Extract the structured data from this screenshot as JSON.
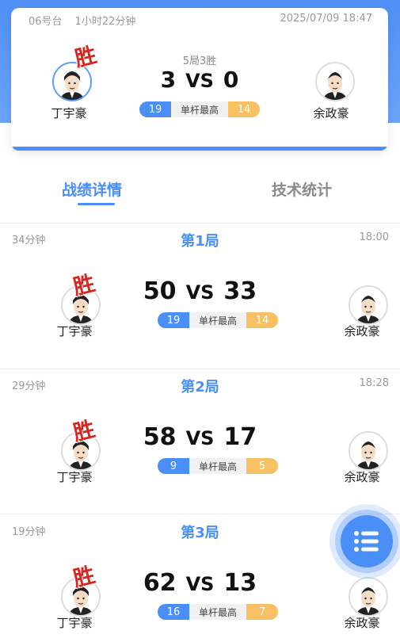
{
  "match": {
    "table": "06号台",
    "duration": "1小时22分钟",
    "datetime": "2025/07/09 18:47",
    "format": "5局3胜",
    "left_player": "丁宇豪",
    "right_player": "余政豪",
    "left_score": "3",
    "right_score": "0",
    "vs": "VS",
    "win_label": "胜",
    "highbreak_label": "单杆最高",
    "left_highbreak": "19",
    "right_highbreak": "14"
  },
  "tabs": {
    "active": "战绩详情",
    "inactive": "技术统计"
  },
  "frames": [
    {
      "title": "第1局",
      "duration": "34分钟",
      "time": "18:00",
      "left_player": "丁宇豪",
      "right_player": "余政豪",
      "left_score": "50",
      "right_score": "33",
      "left_highbreak": "19",
      "right_highbreak": "14",
      "vs": "VS",
      "win_label": "胜",
      "highbreak_label": "单杆最高"
    },
    {
      "title": "第2局",
      "duration": "29分钟",
      "time": "18:28",
      "left_player": "丁宇豪",
      "right_player": "余政豪",
      "left_score": "58",
      "right_score": "17",
      "left_highbreak": "9",
      "right_highbreak": "5",
      "vs": "VS",
      "win_label": "胜",
      "highbreak_label": "单杆最高"
    },
    {
      "title": "第3局",
      "duration": "19分钟",
      "time": "",
      "left_player": "丁宇豪",
      "right_player": "余政豪",
      "left_score": "62",
      "right_score": "13",
      "left_highbreak": "16",
      "right_highbreak": "7",
      "vs": "VS",
      "win_label": "胜",
      "highbreak_label": "单杆最高"
    }
  ],
  "fab": {
    "icon": "list-icon"
  },
  "colors": {
    "accent": "#4a8ef7",
    "left_stat": "#4a8ef7",
    "right_stat": "#f7c063",
    "win": "#d8261f"
  }
}
